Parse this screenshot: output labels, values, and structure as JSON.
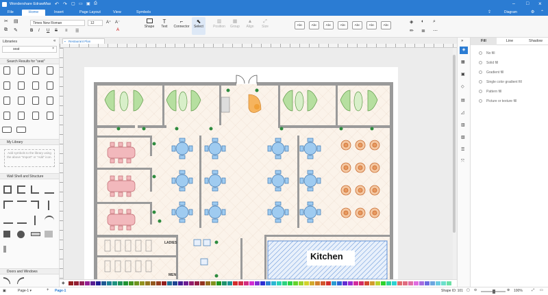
{
  "app": {
    "title": "Wondershare EdrawMax"
  },
  "account": {
    "label": "Diagram"
  },
  "menu": {
    "items": [
      "File",
      "Home",
      "Insert",
      "Page Layout",
      "View",
      "Symbols"
    ],
    "active": "Home"
  },
  "ribbon": {
    "font_name": "Times New Roman",
    "font_size": "12",
    "tools": [
      "Shape",
      "Text",
      "Connector",
      "Select"
    ],
    "disabled_tools": [
      "Position",
      "Group",
      "Align",
      "Size"
    ],
    "style_label": "Abc"
  },
  "libraries": {
    "title": "Libraries",
    "search_value": "seat",
    "search_results_title": "Search Results for \"seat\"",
    "my_library_title": "My Library",
    "my_library_hint": "Add symbols to the library using the above \"Import\" or \"Add\" icon.",
    "wall_title": "Wall Shell and Structure",
    "doors_title": "Doors and Windows"
  },
  "document": {
    "tab_label": "Restaurant Plan"
  },
  "floorplan": {
    "ladies_label": "LADIES",
    "men_label": "MEN",
    "kitchen_label": "Kitchen"
  },
  "right_panel": {
    "tabs": [
      "Fill",
      "Line",
      "Shadow"
    ],
    "active_tab": "Fill",
    "fill_options": [
      "No fill",
      "Solid fill",
      "Gradient fill",
      "Single color gradient fill",
      "Pattern fill",
      "Picture or texture fill"
    ]
  },
  "status": {
    "page_selector": "Page-1",
    "page_tab": "Page-1",
    "shape_id": "Shape ID: 101",
    "zoom": "100%"
  },
  "colors": {
    "brand": "#2b7cd3",
    "sofa_green": "#b6dfa0",
    "chair_blue": "#9fcbf0",
    "chair_pink": "#f2b8bc",
    "round_orange": "#f4c7a1",
    "kitchen_hatch": "#5b8ed6"
  }
}
